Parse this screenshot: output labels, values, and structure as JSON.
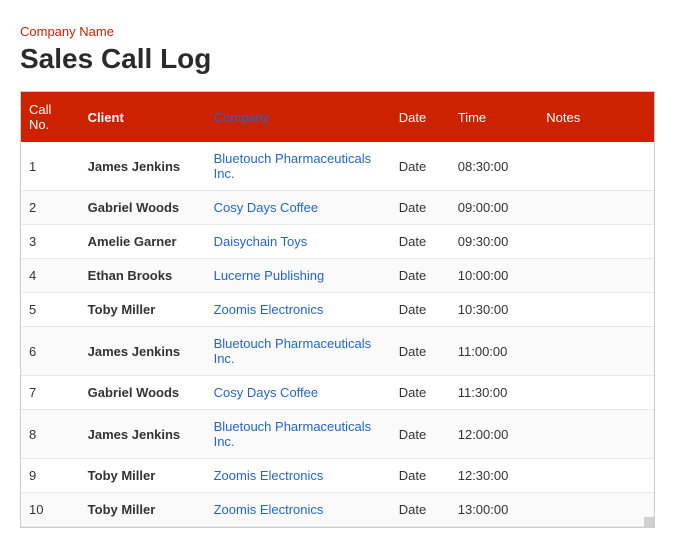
{
  "header": {
    "company_name": "Company Name",
    "page_title": "Sales Call Log"
  },
  "table": {
    "columns": {
      "call_no": "Call No.",
      "client": "Client",
      "company": "Company",
      "date": "Date",
      "time": "Time",
      "notes": "Notes"
    },
    "rows": [
      {
        "call_no": "1",
        "client": "James Jenkins",
        "company": "Bluetouch Pharmaceuticals Inc.",
        "date": "Date",
        "time": "08:30:00",
        "notes": ""
      },
      {
        "call_no": "2",
        "client": "Gabriel Woods",
        "company": "Cosy Days Coffee",
        "date": "Date",
        "time": "09:00:00",
        "notes": ""
      },
      {
        "call_no": "3",
        "client": "Amelie Garner",
        "company": "Daisychain Toys",
        "date": "Date",
        "time": "09:30:00",
        "notes": ""
      },
      {
        "call_no": "4",
        "client": "Ethan Brooks",
        "company": "Lucerne Publishing",
        "date": "Date",
        "time": "10:00:00",
        "notes": ""
      },
      {
        "call_no": "5",
        "client": "Toby Miller",
        "company": "Zoomis Electronics",
        "date": "Date",
        "time": "10:30:00",
        "notes": ""
      },
      {
        "call_no": "6",
        "client": "James Jenkins",
        "company": "Bluetouch Pharmaceuticals Inc.",
        "date": "Date",
        "time": "11:00:00",
        "notes": ""
      },
      {
        "call_no": "7",
        "client": "Gabriel Woods",
        "company": "Cosy Days Coffee",
        "date": "Date",
        "time": "11:30:00",
        "notes": ""
      },
      {
        "call_no": "8",
        "client": "James Jenkins",
        "company": "Bluetouch Pharmaceuticals Inc.",
        "date": "Date",
        "time": "12:00:00",
        "notes": ""
      },
      {
        "call_no": "9",
        "client": "Toby Miller",
        "company": "Zoomis Electronics",
        "date": "Date",
        "time": "12:30:00",
        "notes": ""
      },
      {
        "call_no": "10",
        "client": "Toby Miller",
        "company": "Zoomis Electronics",
        "date": "Date",
        "time": "13:00:00",
        "notes": ""
      }
    ]
  }
}
